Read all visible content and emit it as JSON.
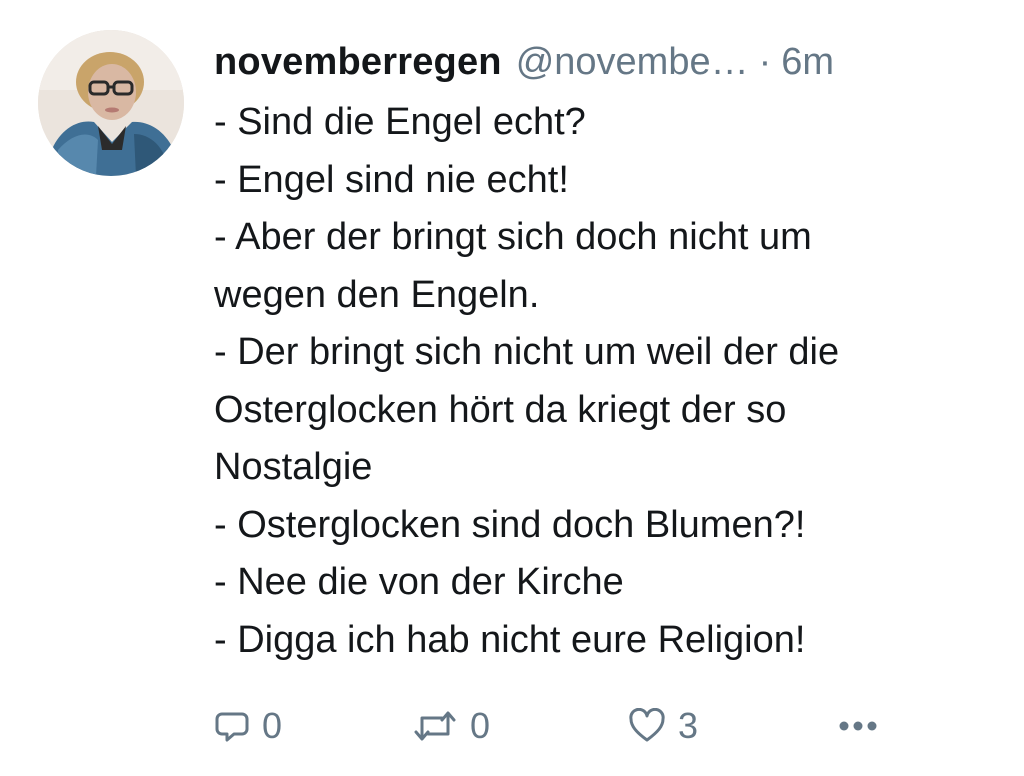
{
  "tweet": {
    "author": {
      "display_name": "novemberregen",
      "handle": "@novembe…",
      "avatar": "user-avatar-photo"
    },
    "separator": "·",
    "timestamp": "6m",
    "lines": [
      "- Sind die Engel echt?",
      "- Engel sind nie echt!",
      "- Aber der bringt sich doch nicht um",
      "wegen den Engeln.",
      "- Der bringt sich nicht um weil der die",
      "Osterglocken hört da kriegt der so",
      "Nostalgie",
      "- Osterglocken sind doch Blumen?!",
      "- Nee die von der Kirche",
      "- Digga ich hab nicht eure Religion!"
    ],
    "actions": {
      "reply": {
        "icon": "reply-icon",
        "count": "0"
      },
      "retweet": {
        "icon": "retweet-icon",
        "count": "0"
      },
      "like": {
        "icon": "heart-icon",
        "count": "3"
      },
      "more": {
        "icon": "more-icon"
      }
    }
  },
  "colors": {
    "text_primary": "#14171a",
    "text_secondary": "#657786",
    "background": "#ffffff"
  }
}
